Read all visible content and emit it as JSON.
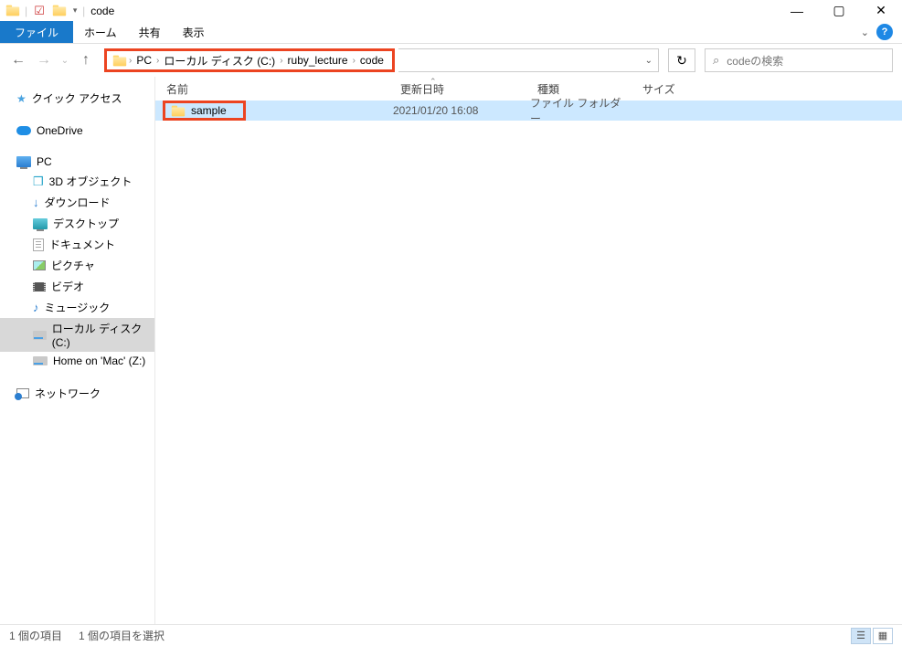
{
  "title": "code",
  "ribbon": {
    "file": "ファイル",
    "home": "ホーム",
    "share": "共有",
    "view": "表示"
  },
  "breadcrumb": [
    "PC",
    "ローカル ディスク (C:)",
    "ruby_lecture",
    "code"
  ],
  "search_placeholder": "codeの検索",
  "columns": {
    "name": "名前",
    "date": "更新日時",
    "type": "種類",
    "size": "サイズ"
  },
  "rows": [
    {
      "name": "sample",
      "date": "2021/01/20 16:08",
      "type": "ファイル フォルダー",
      "size": ""
    }
  ],
  "sidebar": {
    "quick_access": "クイック アクセス",
    "onedrive": "OneDrive",
    "pc": "PC",
    "objects3d": "3D オブジェクト",
    "downloads": "ダウンロード",
    "desktop": "デスクトップ",
    "documents": "ドキュメント",
    "pictures": "ピクチャ",
    "videos": "ビデオ",
    "music": "ミュージック",
    "local_disk": "ローカル ディスク (C:)",
    "home_mac": "Home on 'Mac' (Z:)",
    "network": "ネットワーク"
  },
  "status": {
    "items": "1 個の項目",
    "selected": "1 個の項目を選択"
  }
}
